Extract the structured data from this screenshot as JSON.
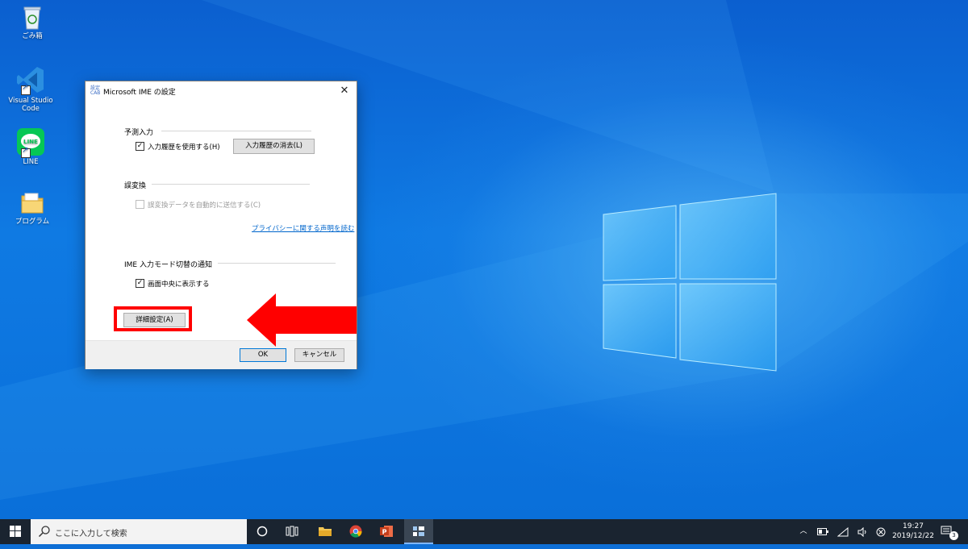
{
  "desktop": {
    "icons": [
      {
        "label": "ごみ箱",
        "name": "recycle-bin"
      },
      {
        "label": "Visual Studio Code",
        "name": "vscode"
      },
      {
        "label": "LINE",
        "name": "line"
      },
      {
        "label": "プログラム",
        "name": "programs-folder"
      }
    ]
  },
  "dialog": {
    "title": "Microsoft IME の設定",
    "close_glyph": "✕",
    "predictive_group": {
      "label": "予測入力",
      "use_history_label": "入力履歴を使用する(H)",
      "use_history_checked": true,
      "clear_history_button": "入力履歴の消去(L)"
    },
    "misconversion_group": {
      "label": "誤変換",
      "send_data_label": "誤変換データを自動的に送信する(C)",
      "send_data_checked": false,
      "send_data_enabled": false
    },
    "privacy_link": "プライバシーに関する声明を読む",
    "notify_group": {
      "label": "IME 入力モード切替の通知",
      "show_center_label": "画面中央に表示する",
      "show_center_checked": true
    },
    "advanced_button": "詳細設定(A)",
    "ok_button": "OK",
    "cancel_button": "キャンセル"
  },
  "annotation": {
    "highlight_color": "#ff0000",
    "arrow_color": "#ff0000"
  },
  "taskbar": {
    "search_placeholder": "ここに入力して検索",
    "clock_time": "19:27",
    "clock_date": "2019/12/22",
    "notification_count": "3",
    "icons": [
      "windows-start-icon",
      "search-icon",
      "cortana-icon",
      "task-view-icon",
      "file-explorer-icon",
      "chrome-icon",
      "powerpoint-icon",
      "ime-settings-icon"
    ]
  },
  "colors": {
    "desktop_blue": "#0e6fd6",
    "taskbar": "#1a2430",
    "link": "#0066cc"
  }
}
